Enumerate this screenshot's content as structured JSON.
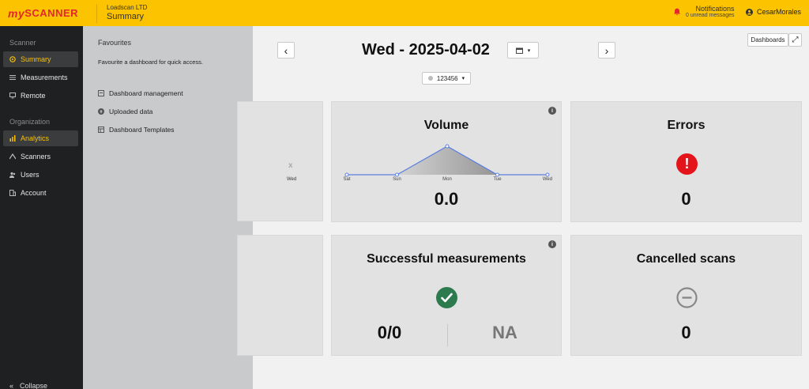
{
  "header": {
    "logo_my": "my",
    "logo_scanner": "SCANNER",
    "company": "Loadscan LTD",
    "page": "Summary",
    "notifications_label": "Notifications",
    "notifications_sub": "0 unread messages",
    "user": "CesarMorales"
  },
  "sidebar": {
    "section_scanner": "Scanner",
    "items_scanner": [
      {
        "label": "Summary",
        "icon": "summary-icon",
        "active": true
      },
      {
        "label": "Measurements",
        "icon": "list-icon"
      },
      {
        "label": "Remote",
        "icon": "monitor-icon"
      }
    ],
    "section_org": "Organization",
    "items_org": [
      {
        "label": "Analytics",
        "icon": "chart-icon",
        "active": true
      },
      {
        "label": "Scanners",
        "icon": "scanner-icon"
      },
      {
        "label": "Users",
        "icon": "users-icon"
      },
      {
        "label": "Account",
        "icon": "building-icon"
      }
    ],
    "collapse": "Collapse",
    "collapse_glyph": "«"
  },
  "flyout": {
    "title": "Favourites",
    "description": "Favourite a dashboard for quick access.",
    "items": [
      {
        "label": "Dashboard management",
        "icon": "dashboard-icon"
      },
      {
        "label": "Uploaded data",
        "icon": "upload-icon"
      },
      {
        "label": "Dashboard Templates",
        "icon": "template-icon"
      }
    ]
  },
  "main": {
    "date": "Wed - 2025-04-02",
    "prev_glyph": "‹",
    "next_glyph": "›",
    "calendar_caret": "▾",
    "scanner_select": "123456",
    "dashboards_button": "Dashboards",
    "expand_glyph": "⤢",
    "info_glyph": "i",
    "partial_card": {
      "x_mark": "x",
      "day": "Wed"
    },
    "volume": {
      "title": "Volume",
      "value": "0.0"
    },
    "errors": {
      "title": "Errors",
      "value": "0",
      "icon_glyph": "!"
    },
    "successful": {
      "title": "Successful measurements",
      "value": "0/0",
      "secondary": "NA"
    },
    "cancelled": {
      "title": "Cancelled scans",
      "value": "0"
    }
  },
  "chart_data": {
    "type": "area",
    "categories": [
      "Sat",
      "Sun",
      "Mon",
      "Tue",
      "Wed"
    ],
    "values": [
      0,
      0,
      1,
      0,
      0
    ],
    "color": "#5b7fe0"
  }
}
